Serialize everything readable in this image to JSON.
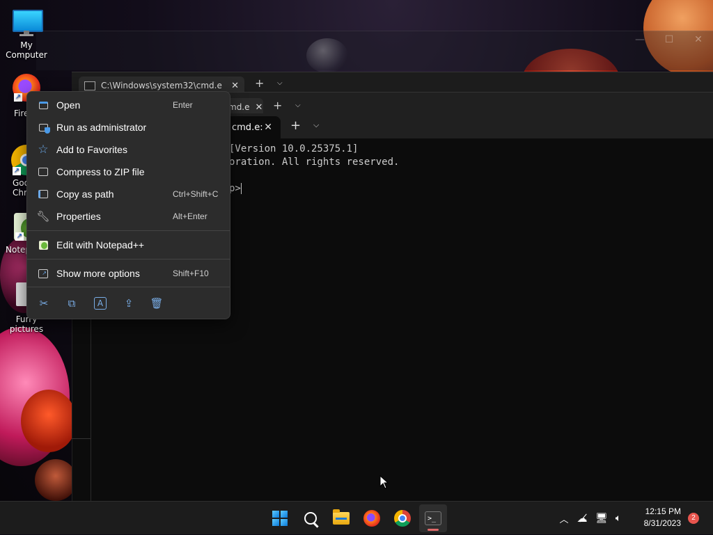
{
  "desktop": {
    "icons": [
      {
        "label": "My Computer"
      },
      {
        "label": "Fire"
      },
      {
        "label": "Goo\nChro"
      },
      {
        "label": "Notep"
      },
      {
        "label": "Furry pictures"
      }
    ]
  },
  "background_windows": {
    "tab1_title": "C:\\Windows\\system32\\cmd.e",
    "tab2_title": "md.e",
    "minimize": "—",
    "maximize": "☐",
    "close": "✕"
  },
  "terminal": {
    "tab_title": "cmd.e:",
    "lines": [
      "[Version 10.0.25375.1]",
      "oration. All rights reserved.",
      "",
      "p>"
    ]
  },
  "context_menu": {
    "items": [
      {
        "label": "Open",
        "shortcut": "Enter",
        "icon": "open-window-icon"
      },
      {
        "label": "Run as administrator",
        "shortcut": "",
        "icon": "shield-icon"
      },
      {
        "label": "Add to Favorites",
        "shortcut": "",
        "icon": "star-icon"
      },
      {
        "label": "Compress to ZIP file",
        "shortcut": "",
        "icon": "zip-icon"
      },
      {
        "label": "Copy as path",
        "shortcut": "Ctrl+Shift+C",
        "icon": "path-icon"
      },
      {
        "label": "Properties",
        "shortcut": "Alt+Enter",
        "icon": "wrench-icon"
      },
      {
        "label": "Edit with Notepad++",
        "shortcut": "",
        "icon": "notepadpp-icon"
      },
      {
        "label": "Show more options",
        "shortcut": "Shift+F10",
        "icon": "more-options-icon"
      }
    ],
    "bottom_actions": [
      "cut-icon",
      "copy-icon",
      "rename-icon",
      "share-icon",
      "delete-icon"
    ]
  },
  "taskbar": {
    "apps": [
      "start-icon",
      "search-icon",
      "file-explorer-icon",
      "firefox-icon",
      "chrome-icon",
      "terminal-icon"
    ],
    "clock_time": "12:15 PM",
    "clock_date": "8/31/2023",
    "notification_count": "2",
    "accent": "#e06a6a"
  }
}
